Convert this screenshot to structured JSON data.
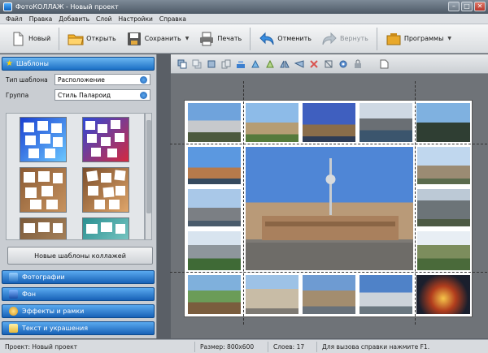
{
  "window": {
    "title": "ФотоКОЛЛАЖ - Новый проект"
  },
  "menu": [
    "Файл",
    "Правка",
    "Добавить",
    "Слой",
    "Настройки",
    "Справка"
  ],
  "toolbar": {
    "new_label": "Новый",
    "open_label": "Открыть",
    "save_label": "Сохранить",
    "print_label": "Печать",
    "undo_label": "Отменить",
    "redo_label": "Вернуть",
    "programs_label": "Программы"
  },
  "left_panel": {
    "templates_header": "Шаблоны",
    "template_type_label": "Тип шаблона",
    "template_type_value": "Расположение",
    "group_label": "Группа",
    "group_value": "Стиль Палароид",
    "new_templates_button": "Новые шаблоны коллажей",
    "sections": [
      {
        "label": "Фотографии",
        "icon": "photos-icon"
      },
      {
        "label": "Фон",
        "icon": "background-icon"
      },
      {
        "label": "Эффекты и рамки",
        "icon": "effects-icon"
      },
      {
        "label": "Текст и украшения",
        "icon": "text-icon"
      }
    ]
  },
  "status": {
    "project": "Проект: Новый проект",
    "size": "Размер: 800x600",
    "layers": "Слоев: 17",
    "hint": "Для вызова справки нажмите F1."
  },
  "colors": {
    "accent": "#1b6fc4",
    "panel": "#c9cdd2",
    "workspace": "#6f7378"
  }
}
